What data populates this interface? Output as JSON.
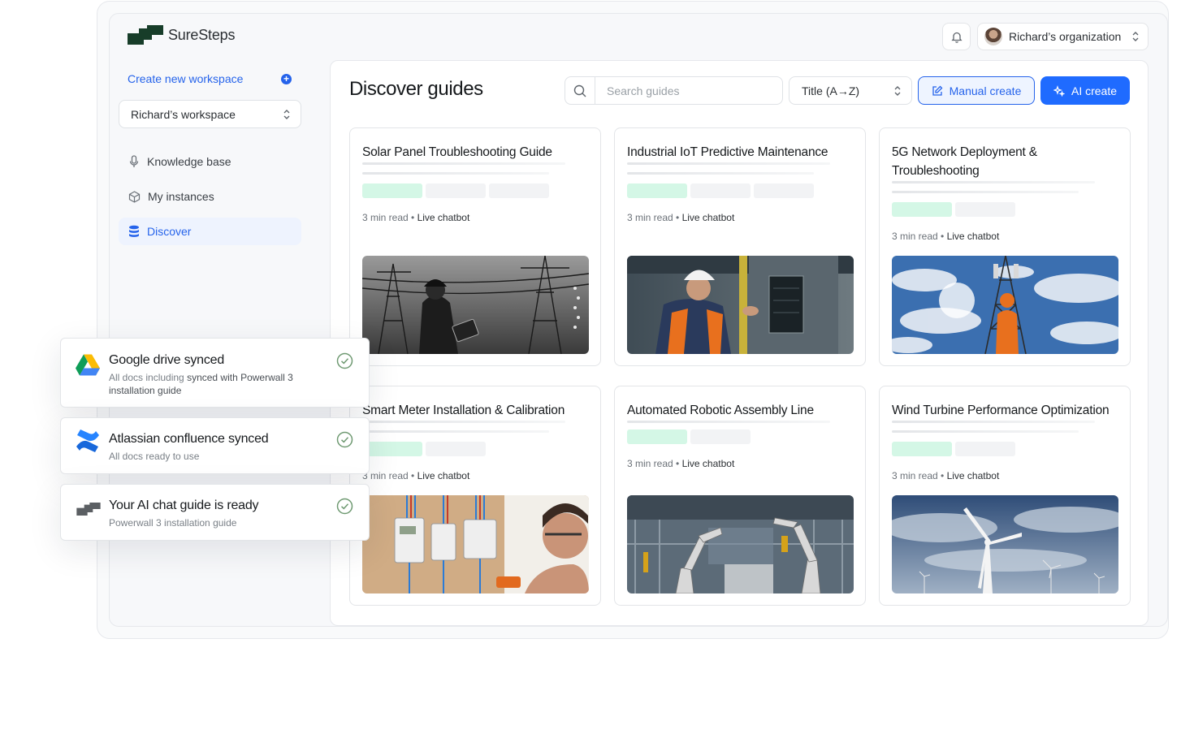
{
  "app": {
    "name": "SureSteps"
  },
  "header": {
    "org_label": "Richard’s organization"
  },
  "sidebar": {
    "create_workspace": "Create new workspace",
    "workspace": "Richard’s workspace",
    "items": [
      {
        "label": "Knowledge base",
        "icon": "microphone-icon"
      },
      {
        "label": "My instances",
        "icon": "cube-icon"
      },
      {
        "label": "Discover",
        "icon": "database-icon",
        "active": true
      }
    ]
  },
  "main": {
    "title": "Discover guides",
    "search_placeholder": "Search guides",
    "sort_value": "Title (A→Z)",
    "manual_create": "Manual create",
    "ai_create": "AI create"
  },
  "meta_sep": " • ",
  "guides": [
    {
      "title": "Solar Panel Troubleshooting Guide",
      "read": "3 min read",
      "tag": "Live chatbot",
      "image": "powerlines-worker-tablet"
    },
    {
      "title": "Industrial IoT Predictive Maintenance",
      "read": "3 min read",
      "tag": "Live chatbot",
      "image": "engineer-control-panel"
    },
    {
      "title": "5G Network Deployment & Troubleshooting",
      "read": "3 min read",
      "tag": "Live chatbot",
      "image": "tower-climber-sky"
    },
    {
      "title": "Smart Meter Installation & Calibration",
      "read": "3 min read",
      "tag": "Live chatbot",
      "image": "electrician-meters"
    },
    {
      "title": "Automated Robotic Assembly Line",
      "read": "3 min read",
      "tag": "Live chatbot",
      "image": "robot-arms-factory"
    },
    {
      "title": "Wind Turbine Performance Optimization",
      "read": "3 min read",
      "tag": "Live chatbot",
      "image": "wind-turbines"
    }
  ],
  "notifications": [
    {
      "title": "Google drive synced",
      "sub_a": "All docs including ",
      "sub_b": "synced with Powerwall 3 installation guide",
      "icon": "google-drive-icon"
    },
    {
      "title": "Atlassian confluence synced",
      "sub_a": "All docs ready to use",
      "icon": "confluence-icon"
    },
    {
      "title": "Your AI chat guide is ready",
      "sub_a": "Powerwall 3 installation guide",
      "icon": "suresteps-logo-icon"
    }
  ],
  "colors": {
    "accent": "#2563eb",
    "brand_dark": "#1f3a2a",
    "skeleton_green": "#d4f7e6",
    "check_green": "#6f9a72"
  }
}
